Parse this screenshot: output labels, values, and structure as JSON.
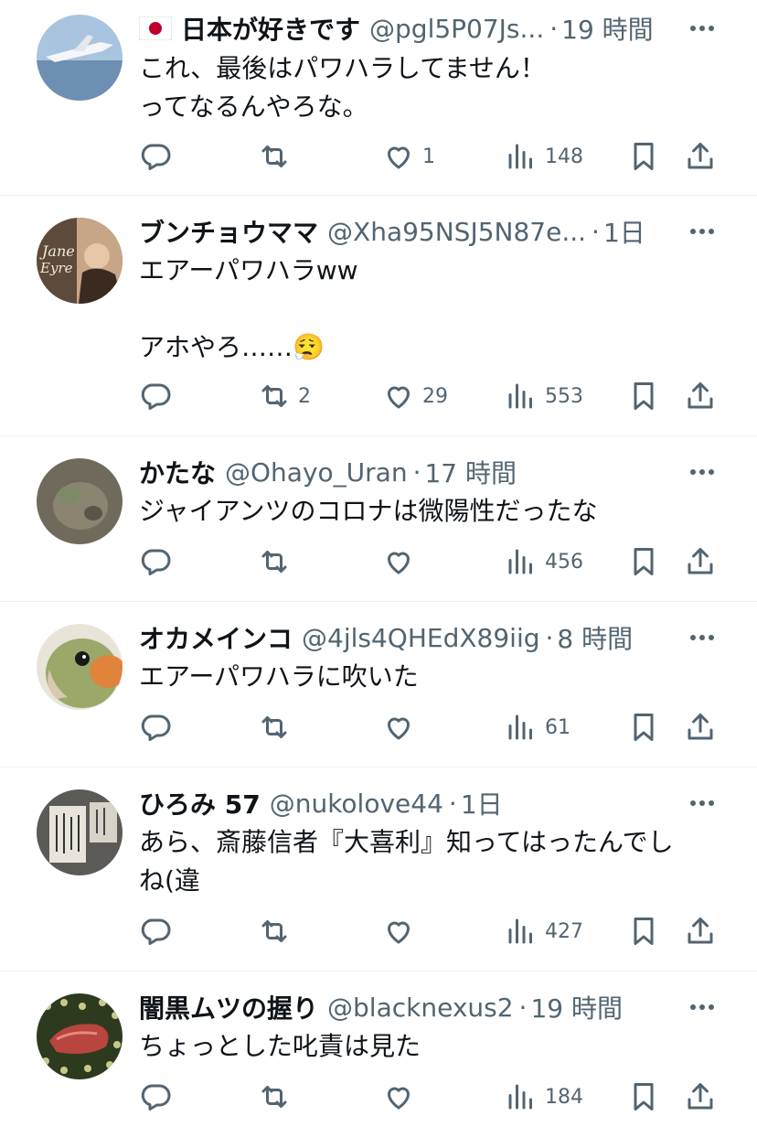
{
  "colors": {
    "text": "#0f1419",
    "secondary": "#536471",
    "divider": "#eff3f4"
  },
  "icons": [
    "reply-icon",
    "retweet-icon",
    "like-icon",
    "views-icon",
    "bookmark-icon",
    "share-icon",
    "more-icon"
  ],
  "replies": [
    {
      "flag": "japan-flag",
      "name": "日本が好きです",
      "handle": "@pgl5P07Js...",
      "time": "19 時間",
      "text": "これ、最後はパワハラしてません！\nってなるんやろな。",
      "retweets": "",
      "likes": "1",
      "views": "148"
    },
    {
      "name": "ブンチョウママ",
      "handle": "@Xha95NSJ5N87e...",
      "time": "1日",
      "text": "エアーパワハラww\n\nアホやろ……😮‍💨",
      "retweets": "2",
      "likes": "29",
      "views": "553"
    },
    {
      "name": "かたな",
      "handle": "@Ohayo_Uran",
      "time": "17 時間",
      "text": "ジャイアンツのコロナは微陽性だったな",
      "retweets": "",
      "likes": "",
      "views": "456"
    },
    {
      "name": "オカメインコ",
      "handle": "@4jls4QHEdX89iig",
      "time": "8 時間",
      "text": "エアーパワハラに吹いた",
      "retweets": "",
      "likes": "",
      "views": "61"
    },
    {
      "name": "ひろみ 57",
      "handle": "@nukolove44",
      "time": "1日",
      "text": "あら、斎藤信者『大喜利』知ってはったんでし\nね(違",
      "retweets": "",
      "likes": "",
      "views": "427"
    },
    {
      "name": "闇黒ムツの握り",
      "handle": "@blacknexus2",
      "time": "19 時間",
      "text": "ちょっとした叱責は見た",
      "retweets": "",
      "likes": "",
      "views": "184"
    }
  ]
}
